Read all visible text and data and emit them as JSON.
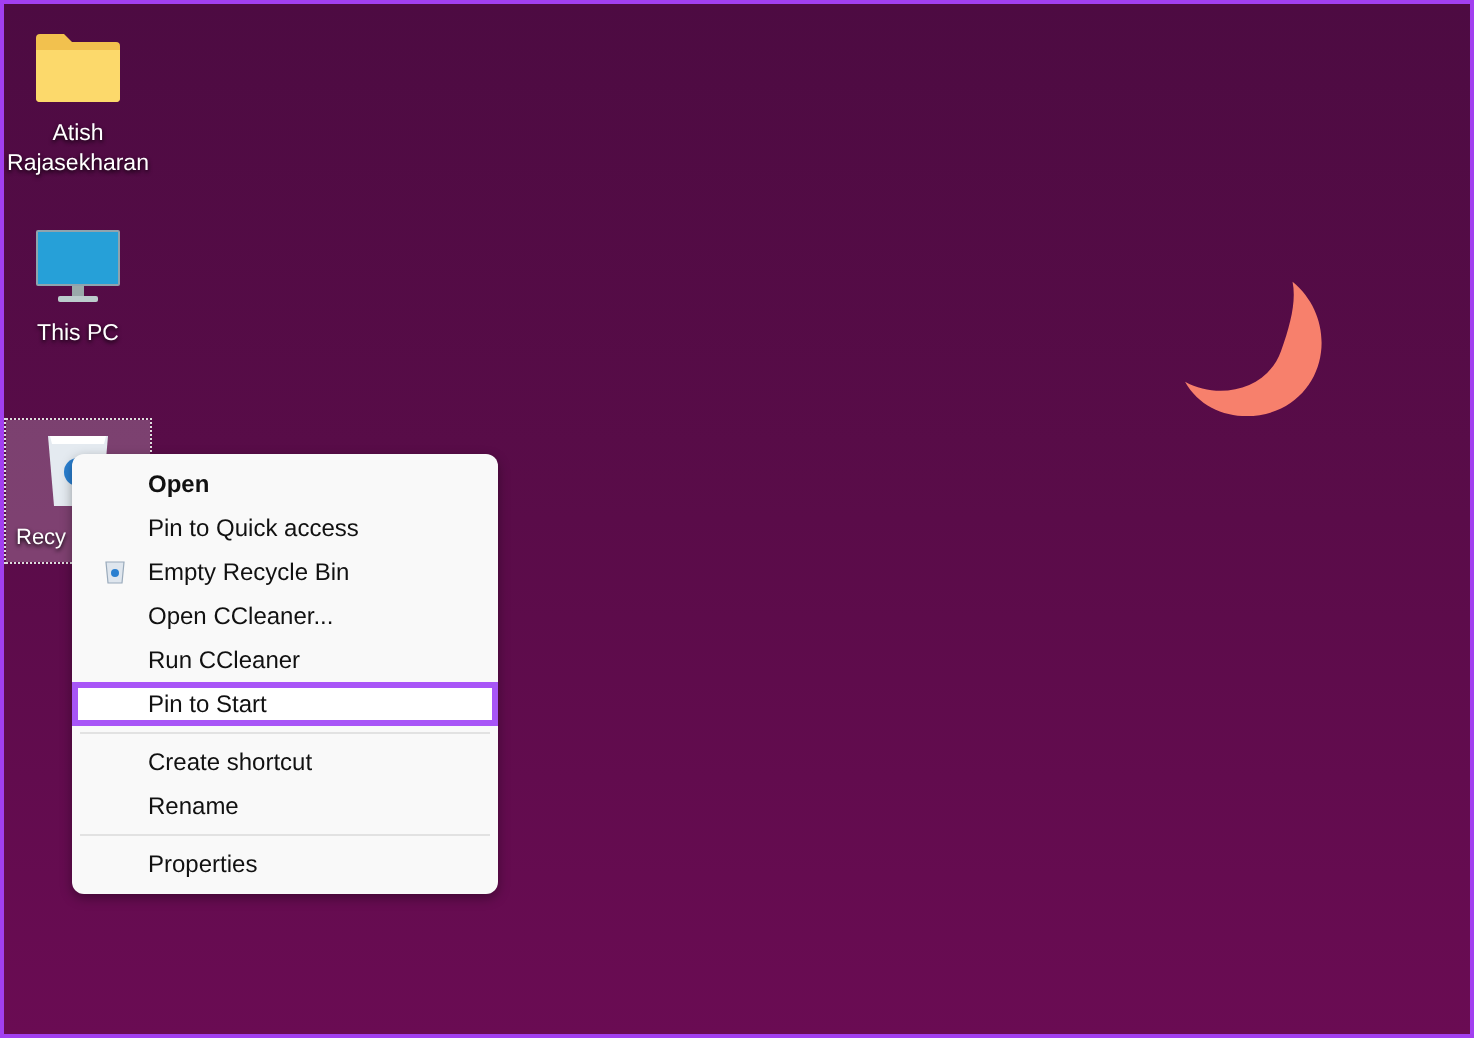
{
  "desktop": {
    "icons": [
      {
        "label": "Atish Rajasekharan",
        "kind": "folder",
        "selected": false
      },
      {
        "label": "This PC",
        "kind": "monitor",
        "selected": false
      },
      {
        "label": "Recy",
        "kind": "recycle-bin",
        "selected": true
      }
    ]
  },
  "context_menu": {
    "items": [
      {
        "kind": "item",
        "label": "Open",
        "bold": true,
        "highlighted": false
      },
      {
        "kind": "item",
        "label": "Pin to Quick access",
        "bold": false,
        "highlighted": false
      },
      {
        "kind": "icon-item",
        "label": "Empty Recycle Bin",
        "bold": false,
        "highlighted": false
      },
      {
        "kind": "item",
        "label": "Open CCleaner...",
        "bold": false,
        "highlighted": false
      },
      {
        "kind": "item",
        "label": "Run CCleaner",
        "bold": false,
        "highlighted": false
      },
      {
        "kind": "item",
        "label": "Pin to Start",
        "bold": false,
        "highlighted": true
      },
      {
        "kind": "separator"
      },
      {
        "kind": "item",
        "label": "Create shortcut",
        "bold": false,
        "highlighted": false
      },
      {
        "kind": "item",
        "label": "Rename",
        "bold": false,
        "highlighted": false
      },
      {
        "kind": "separator"
      },
      {
        "kind": "item",
        "label": "Properties",
        "bold": false,
        "highlighted": false
      }
    ]
  }
}
